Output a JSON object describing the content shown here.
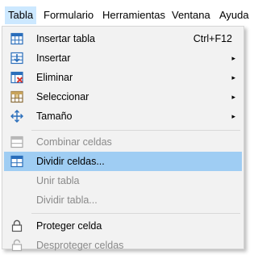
{
  "menubar": {
    "items": [
      {
        "label": "Tabla"
      },
      {
        "label": "Formulario"
      },
      {
        "label": "Herramientas"
      },
      {
        "label": "Ventana"
      },
      {
        "label": "Ayuda"
      }
    ]
  },
  "menu": {
    "insert_table": {
      "label": "Insertar tabla",
      "shortcut": "Ctrl+F12"
    },
    "insert": {
      "label": "Insertar"
    },
    "delete": {
      "label": "Eliminar"
    },
    "select": {
      "label": "Seleccionar"
    },
    "size": {
      "label": "Tamaño"
    },
    "merge_cells": {
      "label": "Combinar celdas"
    },
    "split_cells": {
      "label": "Dividir celdas..."
    },
    "merge_table": {
      "label": "Unir tabla"
    },
    "split_table": {
      "label": "Dividir tabla..."
    },
    "protect_cell": {
      "label": "Proteger celda"
    },
    "unprotect_cells": {
      "label": "Desproteger celdas"
    },
    "submenu_arrow": "▸"
  },
  "colors": {
    "highlight": "#9fcdf3",
    "menubar_active": "#cce8ff",
    "disabled_text": "#8a8a8a",
    "icon_blue": "#2a6ebb",
    "icon_red": "#d9342b"
  }
}
